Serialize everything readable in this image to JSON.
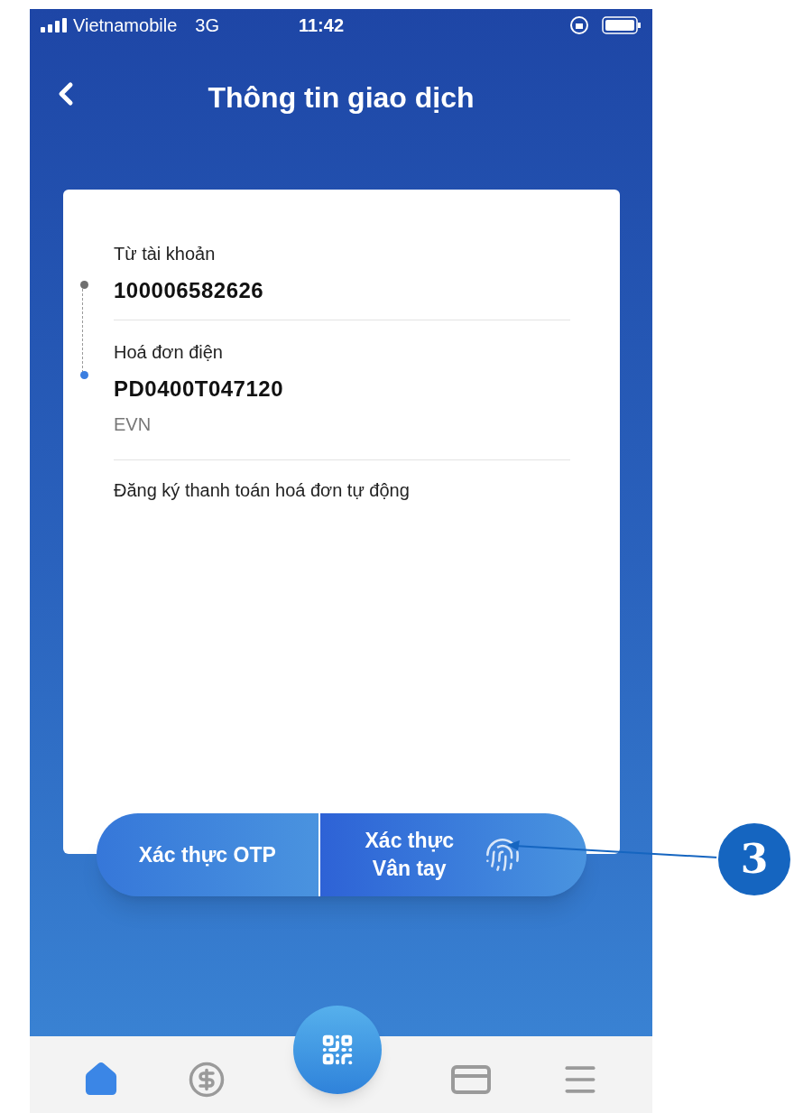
{
  "status_bar": {
    "carrier": "Vietnamobile",
    "network": "3G",
    "time": "11:42"
  },
  "header": {
    "title": "Thông tin giao dịch"
  },
  "transaction": {
    "from": {
      "label": "Từ tài khoản",
      "value": "100006582626"
    },
    "bill": {
      "label": "Hoá đơn điện",
      "value": "PD0400T047120",
      "provider": "EVN"
    },
    "auto_pay": "Đăng ký thanh toán hoá đơn tự động"
  },
  "actions": [
    {
      "kind": "otp",
      "label": "Xác thực OTP"
    },
    {
      "kind": "fingerprint",
      "label": "Xác thực\nVân tay"
    }
  ],
  "nav": [
    {
      "kind": "home",
      "selected": true
    },
    {
      "kind": "transfer",
      "selected": false
    },
    {
      "kind": "qr",
      "selected": false
    },
    {
      "kind": "card",
      "selected": false
    },
    {
      "kind": "menu",
      "selected": false
    }
  ],
  "annotation": {
    "label": "3"
  }
}
